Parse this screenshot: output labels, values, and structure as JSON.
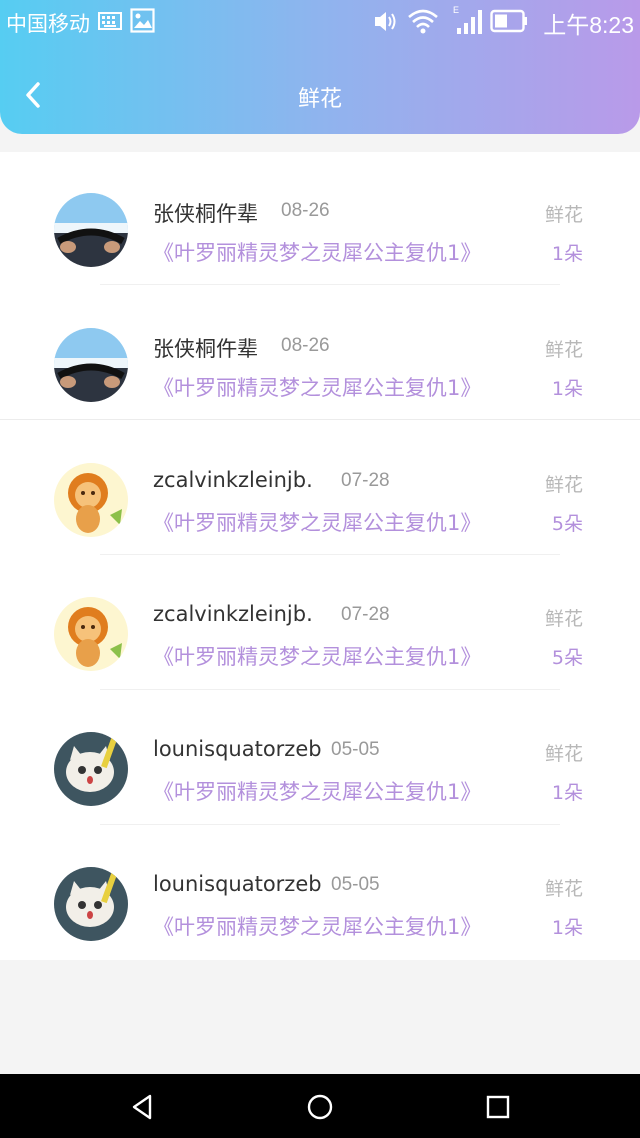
{
  "status": {
    "carrier": "中国移动",
    "time": "上午8:23",
    "icons": [
      "keyboard-icon",
      "image-icon",
      "volume-icon",
      "wifi-icon",
      "signal-icon",
      "battery-icon"
    ]
  },
  "header": {
    "title": "鲜花",
    "back_icon": "chevron-left-icon"
  },
  "colors": {
    "header_gradient": [
      "#56cdf2",
      "#b99ae9"
    ],
    "accent_purple": "#b390dc"
  },
  "list": [
    {
      "name": "张侠桐仵辈",
      "date": "08-26",
      "gift_label": "鲜花",
      "book": "《叶罗丽精灵梦之灵犀公主复仇1》",
      "qty": "1朵",
      "avatar": "car-driving-avatar"
    },
    {
      "name": "张侠桐仵辈",
      "date": "08-26",
      "gift_label": "鲜花",
      "book": "《叶罗丽精灵梦之灵犀公主复仇1》",
      "qty": "1朵",
      "avatar": "car-driving-avatar"
    },
    {
      "name": "zcalvinkzleinjb.",
      "date": "07-28",
      "gift_label": "鲜花",
      "book": "《叶罗丽精灵梦之灵犀公主复仇1》",
      "qty": "5朵",
      "avatar": "lion-cartoon-avatar"
    },
    {
      "name": "zcalvinkzleinjb.",
      "date": "07-28",
      "gift_label": "鲜花",
      "book": "《叶罗丽精灵梦之灵犀公主复仇1》",
      "qty": "5朵",
      "avatar": "lion-cartoon-avatar"
    },
    {
      "name": "lounisquatorzeb",
      "date": "05-05",
      "gift_label": "鲜花",
      "book": "《叶罗丽精灵梦之灵犀公主复仇1》",
      "qty": "1朵",
      "avatar": "cat-cartoon-avatar"
    },
    {
      "name": "lounisquatorzeb",
      "date": "05-05",
      "gift_label": "鲜花",
      "book": "《叶罗丽精灵梦之灵犀公主复仇1》",
      "qty": "1朵",
      "avatar": "cat-cartoon-avatar"
    }
  ],
  "navbar": {
    "icons": [
      "nav-back-icon",
      "nav-home-icon",
      "nav-recent-icon"
    ]
  }
}
